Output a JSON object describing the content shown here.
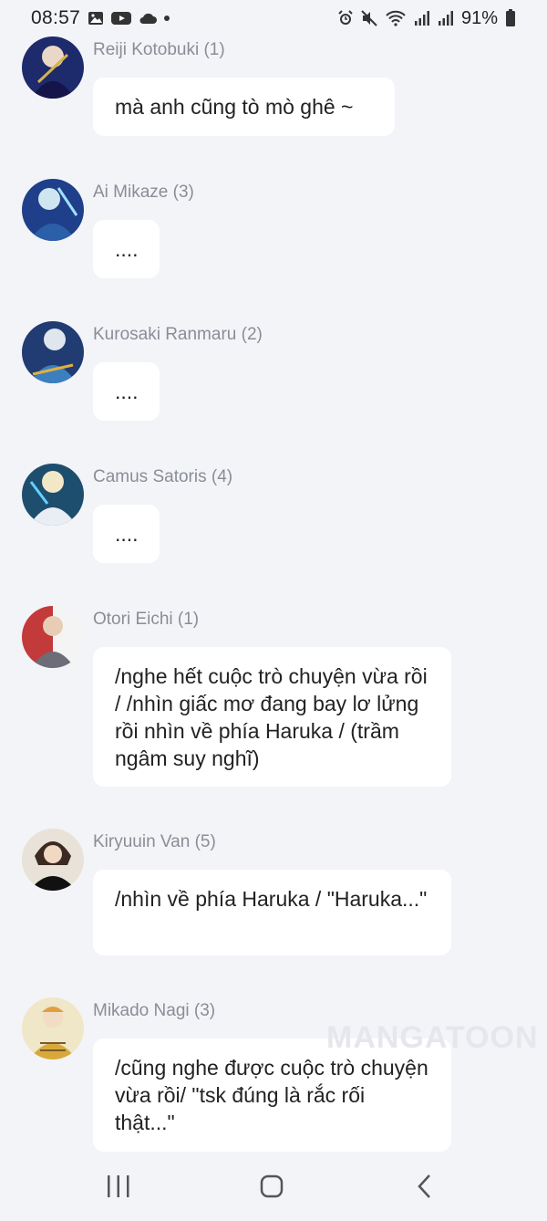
{
  "status_bar": {
    "time": "08:57",
    "battery": "91%",
    "left_icons": [
      "gallery-icon",
      "youtube-icon",
      "cloud-icon",
      "notification-dot-icon"
    ],
    "right_icons": [
      "alarm-icon",
      "mute-icon",
      "wifi-icon",
      "signal-icon",
      "signal-icon",
      "battery-icon"
    ]
  },
  "messages": [
    {
      "name": "Reiji Kotobuki (1)",
      "text": "mà anh cũng tò mò ghê ~",
      "avatar_color": "#1d2a6b"
    },
    {
      "name": "Ai Mikaze (3)",
      "text": "....",
      "avatar_color": "#1f3f8a"
    },
    {
      "name": "Kurosaki Ranmaru (2)",
      "text": "....",
      "avatar_color": "#213b73"
    },
    {
      "name": "Camus Satoris (4)",
      "text": "....",
      "avatar_color": "#1e4e6e"
    },
    {
      "name": "Otori Eichi (1)",
      "text": "/nghe hết cuộc trò chuyện vừa rồi / /nhìn giấc mơ đang bay lơ lửng rồi nhìn về phía Haruka / (trầm ngâm suy nghĩ)",
      "avatar_color": "#c23a3a"
    },
    {
      "name": "Kiryuuin Van (5)",
      "text": "/nhìn về phía Haruka / \"Haruka...\"",
      "avatar_color": "#3b2a22"
    },
    {
      "name": "Mikado Nagi (3)",
      "text": "/cũng nghe được cuộc trò chuyện vừa rồi/ \"tsk đúng là rắc rối thật...\"",
      "avatar_color": "#d8a93a"
    }
  ],
  "watermark": "MANGATOON",
  "nav": {
    "icons": [
      "recent-apps-icon",
      "home-icon",
      "back-icon"
    ]
  }
}
